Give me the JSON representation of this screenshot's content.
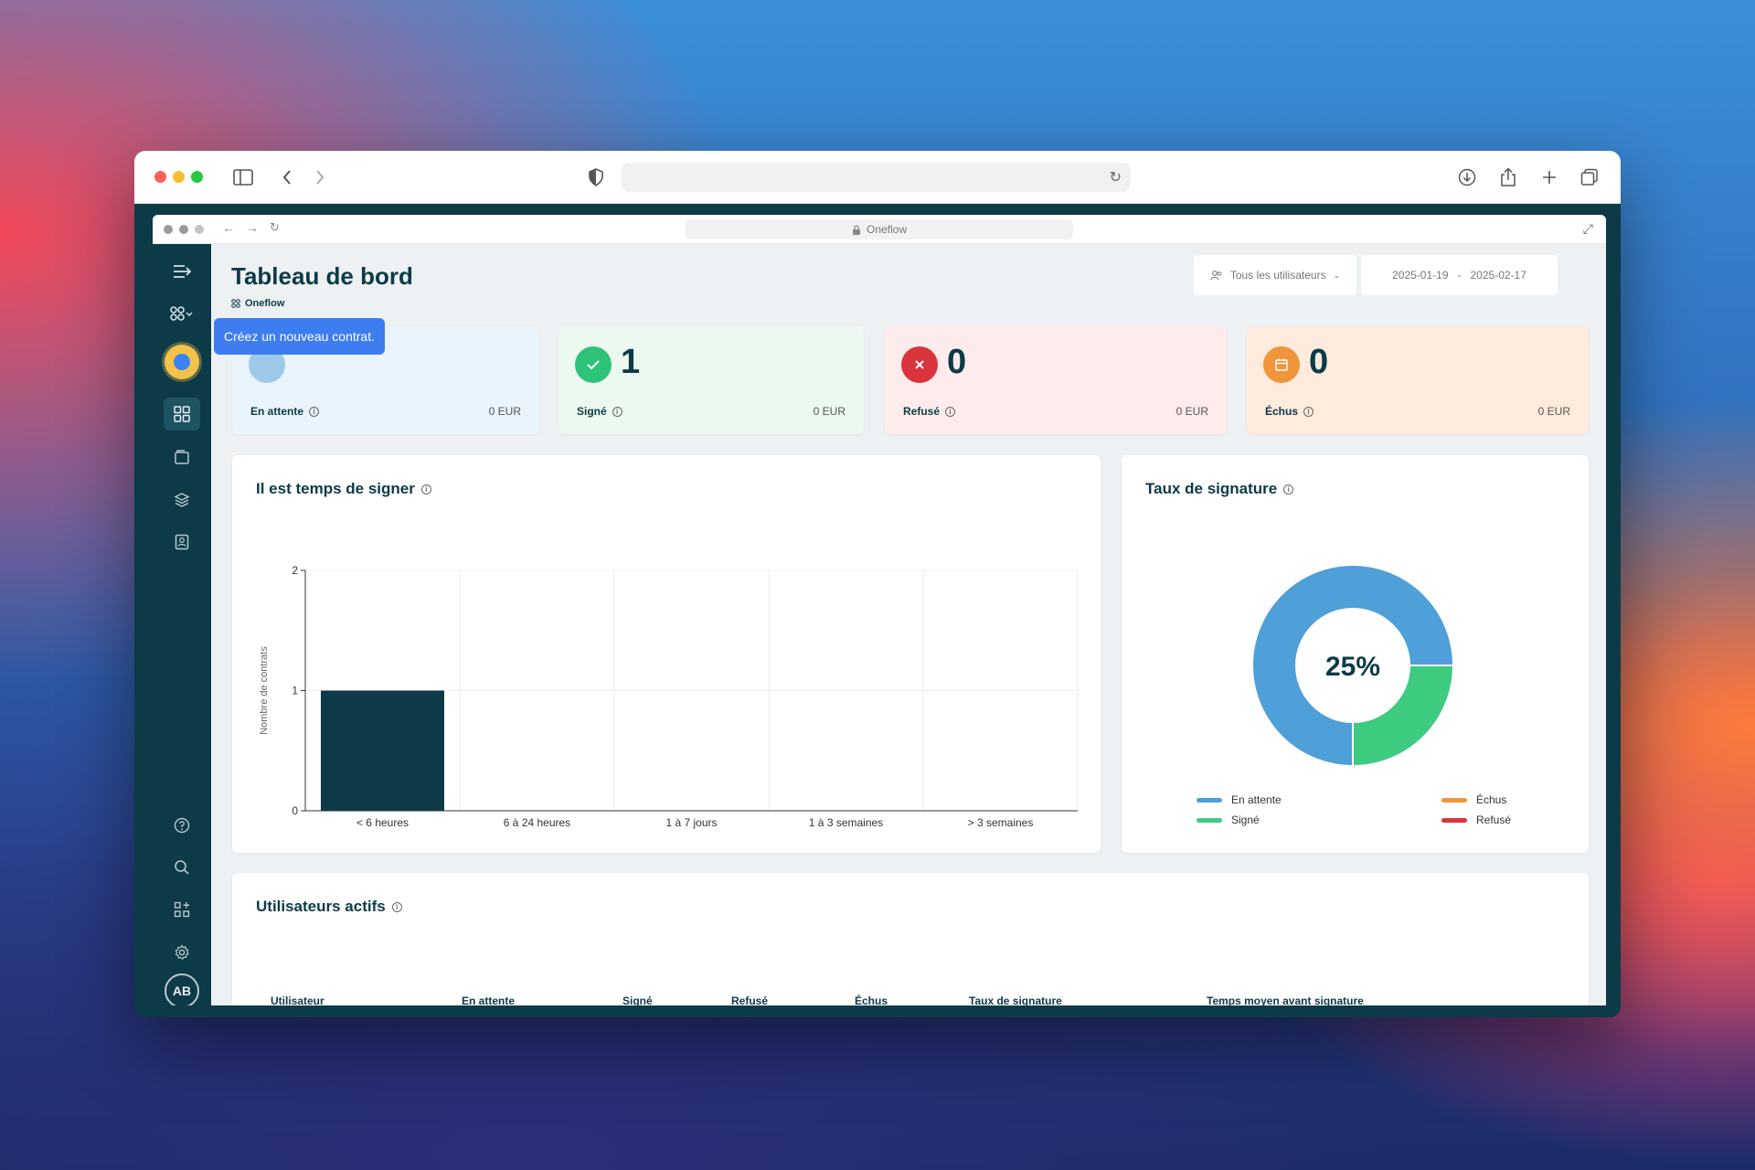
{
  "inner_window": {
    "url": "Oneflow"
  },
  "page": {
    "title": "Tableau de bord",
    "breadcrumb": "Oneflow"
  },
  "filters": {
    "users": "Tous les utilisateurs",
    "date_from": "2025-01-19",
    "date_sep": "-",
    "date_to": "2025-02-17"
  },
  "tooltip": {
    "text": "Créez un nouveau contrat."
  },
  "avatar": {
    "initials": "AB"
  },
  "stats": [
    {
      "key": "pending",
      "value": "",
      "label": "En attente",
      "amount": "0 EUR",
      "color": "#9ec9e8",
      "bg": "#e9f4fc"
    },
    {
      "key": "signed",
      "value": "1",
      "label": "Signé",
      "amount": "0 EUR",
      "color": "#2fc37a",
      "bg": "#ecf9f1"
    },
    {
      "key": "declined",
      "value": "0",
      "label": "Refusé",
      "amount": "0 EUR",
      "color": "#d9343d",
      "bg": "#fdeceb"
    },
    {
      "key": "overdue",
      "value": "0",
      "label": "Échus",
      "amount": "0 EUR",
      "color": "#f0953b",
      "bg": "#fdebdd"
    }
  ],
  "time_card": {
    "title": "Il est temps de signer"
  },
  "rate_card": {
    "title": "Taux de signature",
    "center_label": "25%"
  },
  "users_card": {
    "title": "Utilisateurs actifs",
    "columns": [
      "Utilisateur",
      "En attente",
      "Signé",
      "Refusé",
      "Échus",
      "Taux de signature",
      "Temps moyen avant signature"
    ]
  },
  "chart_data": [
    {
      "type": "bar",
      "title": "Il est temps de signer",
      "categories": [
        "< 6 heures",
        "6 à 24 heures",
        "1 à 7 jours",
        "1 à 3 semaines",
        "> 3 semaines"
      ],
      "values": [
        1,
        0,
        0,
        0,
        0
      ],
      "ylabel": "Nombre de contrats",
      "ylim": [
        0,
        2
      ],
      "yticks": [
        "0",
        "1",
        "2"
      ],
      "bar_color": "#0d3a47",
      "grid": true
    },
    {
      "type": "pie",
      "title": "Taux de signature",
      "donut": true,
      "center_label": "25%",
      "slices": [
        {
          "name": "En attente",
          "value": 75,
          "color": "#4f9fd8"
        },
        {
          "name": "Signé",
          "value": 25,
          "color": "#3dcb80"
        },
        {
          "name": "Échus",
          "value": 0,
          "color": "#f0953b"
        },
        {
          "name": "Refusé",
          "value": 0,
          "color": "#d9343d"
        }
      ],
      "legend_position": "bottom"
    }
  ]
}
